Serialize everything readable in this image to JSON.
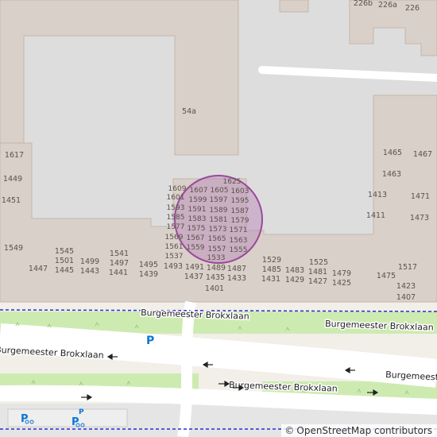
{
  "map": {
    "house_numbers": [
      "226b",
      "226a",
      "226",
      "54a",
      "1617",
      "1449",
      "1451",
      "1549",
      "1625",
      "1609",
      "1607",
      "1605",
      "1603",
      "1601",
      "1599",
      "1597",
      "1595",
      "1593",
      "1591",
      "1589",
      "1587",
      "1585",
      "1583",
      "1581",
      "1579",
      "1577",
      "1575",
      "1573",
      "1571",
      "1569",
      "1567",
      "1565",
      "1563",
      "1561",
      "1559",
      "1557",
      "1555",
      "1537",
      "1533",
      "1545",
      "1501",
      "1445",
      "1447",
      "1499",
      "1443",
      "1541",
      "1497",
      "1441",
      "1495",
      "1439",
      "1493",
      "1491",
      "1437",
      "1489",
      "1435",
      "1487",
      "1433",
      "1401",
      "1529",
      "1485",
      "1431",
      "1483",
      "1429",
      "1525",
      "1481",
      "1427",
      "1479",
      "1425",
      "1475",
      "1517",
      "1423",
      "1407",
      "1465",
      "1467",
      "1463",
      "1413",
      "1471",
      "1411",
      "1473"
    ],
    "street_labels": [
      "Burgemeester Brokxlaan",
      "Burgemeester Brokxlaan",
      "Burgemeester Brokxlaan",
      "Burgemeester Brokxlaan",
      "Burgemeester Brokxlaan"
    ],
    "parking_label": "P",
    "highlight_color": "#b784b7",
    "attribution_symbol": "©",
    "attribution_text": "OpenStreetMap contributors"
  }
}
